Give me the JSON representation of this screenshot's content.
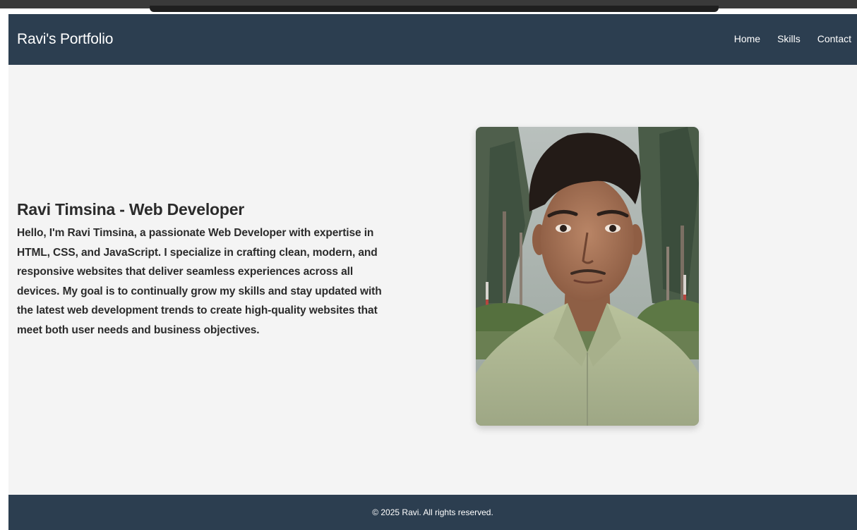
{
  "navbar": {
    "brand": "Ravi's Portfolio",
    "links": [
      {
        "label": "Home"
      },
      {
        "label": "Skills"
      },
      {
        "label": "Contact"
      }
    ]
  },
  "hero": {
    "title": "Ravi Timsina - Web Developer",
    "description": "Hello, I'm Ravi Timsina, a passionate Web Developer with expertise in HTML, CSS, and JavaScript. I specialize in crafting clean, modern, and responsive websites that deliver seamless experiences across all devices. My goal is to continually grow my skills and stay updated with the latest web development trends to create high-quality websites that meet both user needs and business objectives."
  },
  "footer": {
    "copyright": "© 2025 Ravi. All rights reserved."
  },
  "colors": {
    "nav_background": "#2c3e50",
    "page_background": "#f4f4f4",
    "text": "#2b2b2b"
  }
}
